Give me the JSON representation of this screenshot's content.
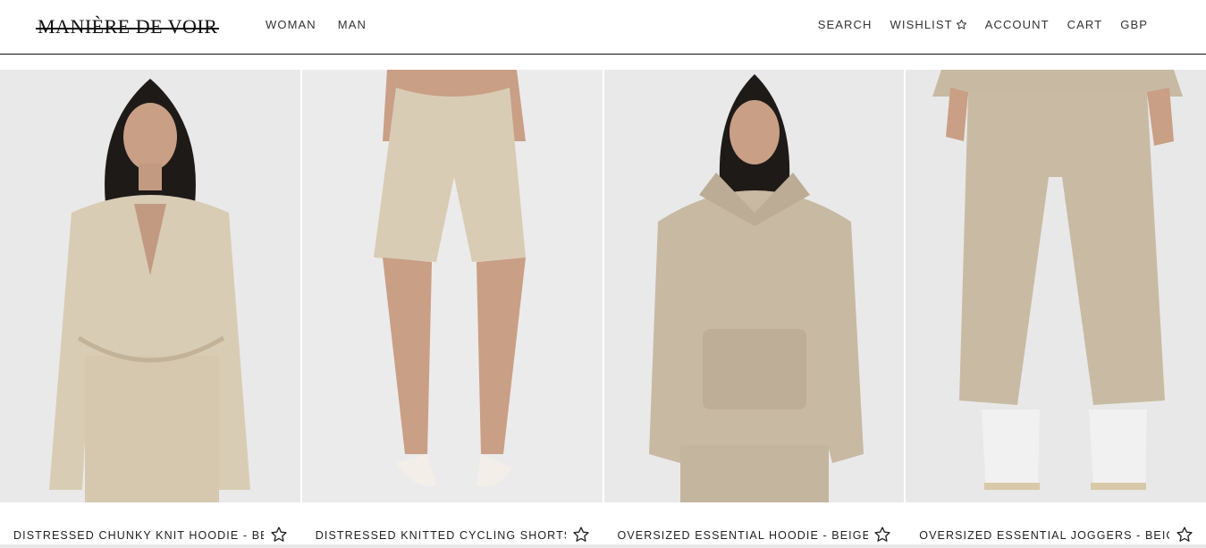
{
  "brand": {
    "logo_text": "MANIÈRE DE VOIR"
  },
  "nav": {
    "left": [
      "WOMAN",
      "MAN"
    ],
    "right": {
      "search": "SEARCH",
      "wishlist": "WISHLIST",
      "account": "ACCOUNT",
      "cart": "CART",
      "currency": "GBP"
    }
  },
  "products": [
    {
      "title": "DISTRESSED CHUNKY KNIT HOODIE - BEIGE",
      "image": "model in beige chunky knit zip hoodie and shorts",
      "icon": "star-outline-icon"
    },
    {
      "title": "DISTRESSED KNITTED CYCLING SHORTS -",
      "image": "model in beige knitted cycling shorts",
      "icon": "star-outline-icon"
    },
    {
      "title": "OVERSIZED ESSENTIAL HOODIE - BEIGE",
      "image": "model in beige oversized hoodie",
      "icon": "star-outline-icon"
    },
    {
      "title": "OVERSIZED ESSENTIAL JOGGERS - BEIGE",
      "image": "model in beige oversized joggers and white sneakers",
      "icon": "star-outline-icon"
    }
  ],
  "colors": {
    "background": "#ffffff",
    "photo_bg": "#ececec",
    "garment": "#d9ccb6",
    "text": "#222222"
  }
}
